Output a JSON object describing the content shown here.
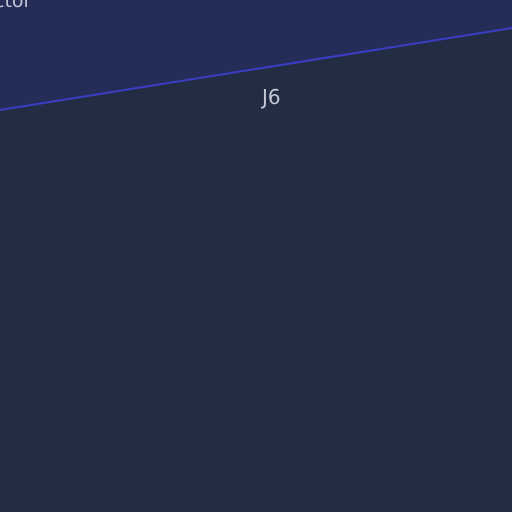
{
  "map": {
    "colors": {
      "background": "#222d44",
      "upper_region": "#232d57",
      "boundary": "#3b3ec4",
      "label": "#c2c7d2"
    },
    "labels": {
      "upper_region_partial": "ctor",
      "zone": "J6"
    }
  }
}
